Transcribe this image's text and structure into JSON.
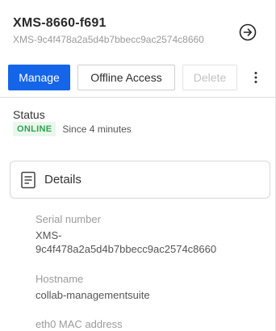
{
  "header": {
    "device_name": "XMS-8660-f691",
    "device_id": "XMS-9c4f478a2a5d4b7bbecc9ac2574c8660"
  },
  "toolbar": {
    "manage_label": "Manage",
    "offline_access_label": "Offline Access",
    "delete_label": "Delete"
  },
  "status": {
    "label": "Status",
    "badge": "ONLINE",
    "since": "Since 4 minutes"
  },
  "details": {
    "title": "Details",
    "fields": [
      {
        "label": "Serial number",
        "value": "XMS-\n9c4f478a2a5d4b7bbecc9ac2574c8660"
      },
      {
        "label": "Hostname",
        "value": "collab-managementsuite"
      },
      {
        "label": "eth0 MAC address",
        "value": ""
      }
    ]
  },
  "icons": {
    "goto": "arrow-circle-right-icon",
    "more": "vertical-dots-icon",
    "details": "document-icon"
  },
  "colors": {
    "primary": "#1565e8",
    "online_text": "#2ea44f",
    "online_bg": "#e9f7ed"
  }
}
